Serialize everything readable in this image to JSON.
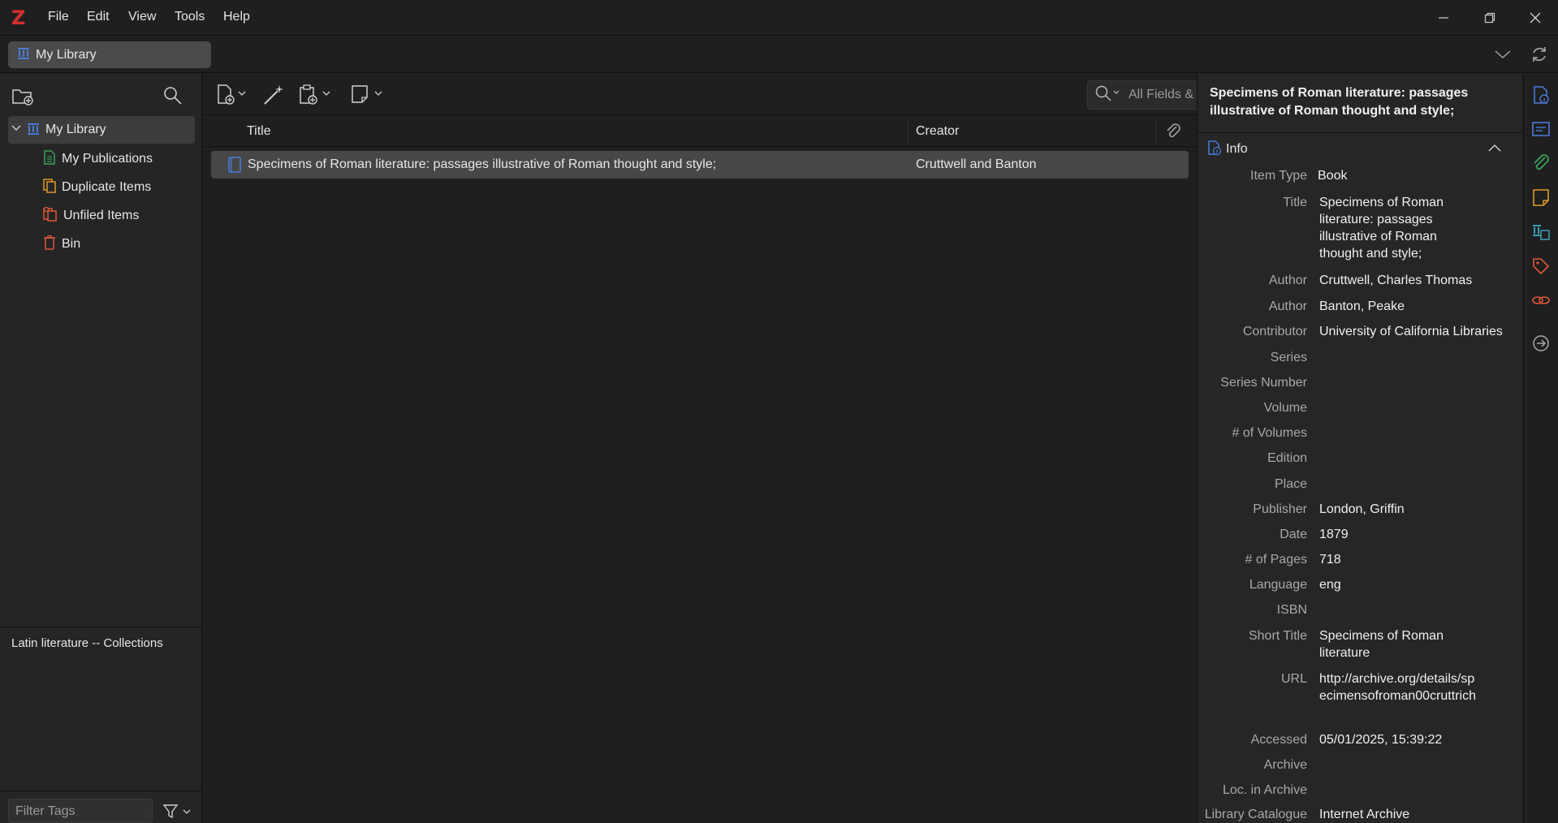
{
  "app": {
    "logo": "Z"
  },
  "menu": [
    "File",
    "Edit",
    "View",
    "Tools",
    "Help"
  ],
  "tab": {
    "label": "My Library"
  },
  "collections": {
    "root": "My Library",
    "items": [
      "My Publications",
      "Duplicate Items",
      "Unfiled Items",
      "Bin"
    ]
  },
  "tags": {
    "items": [
      "Latin literature -- Collections"
    ],
    "filter_placeholder": "Filter Tags"
  },
  "search": {
    "placeholder": "All Fields & Tags"
  },
  "columns": {
    "title": "Title",
    "creator": "Creator"
  },
  "rows": [
    {
      "title": "Specimens of Roman literature: passages illustrative of Roman thought and style;",
      "creator": "Cruttwell and Banton"
    }
  ],
  "item": {
    "header_title": "Specimens of Roman literature: passages illustrative of Roman thought and style;",
    "section": "Info",
    "fields": [
      {
        "label": "Item Type",
        "value": "Book"
      },
      {
        "label": "Title",
        "value": "Specimens of Roman literature: passages illustrative of Roman thought and style;"
      },
      {
        "label": "Author",
        "value": "Cruttwell, Charles Thomas"
      },
      {
        "label": "Author",
        "value": "Banton, Peake"
      },
      {
        "label": "Contributor",
        "value": "University of California Libraries"
      },
      {
        "label": "Series",
        "value": ""
      },
      {
        "label": "Series Number",
        "value": ""
      },
      {
        "label": "Volume",
        "value": ""
      },
      {
        "label": "# of Volumes",
        "value": ""
      },
      {
        "label": "Edition",
        "value": ""
      },
      {
        "label": "Place",
        "value": ""
      },
      {
        "label": "Publisher",
        "value": "London, Griffin"
      },
      {
        "label": "Date",
        "value": "1879"
      },
      {
        "label": "# of Pages",
        "value": "718"
      },
      {
        "label": "Language",
        "value": "eng"
      },
      {
        "label": "ISBN",
        "value": ""
      },
      {
        "label": "Short Title",
        "value": "Specimens of Roman literature"
      },
      {
        "label": "URL",
        "value": "http://archive.org/details/specimensofroman00cruttrich"
      },
      {
        "label": "Accessed",
        "value": "05/01/2025, 15:39:22"
      },
      {
        "label": "Archive",
        "value": ""
      },
      {
        "label": "Loc. in Archive",
        "value": ""
      },
      {
        "label": "Library Catalogue",
        "value": "Internet Archive"
      }
    ]
  },
  "colors": {
    "accent_blue": "#4a7bd8",
    "green": "#3aa35a",
    "orange": "#e09a2a",
    "red": "#e0583a",
    "teal": "#3aa3b8"
  }
}
